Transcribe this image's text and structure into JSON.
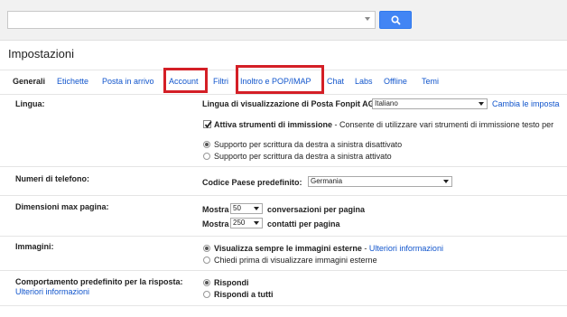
{
  "search": {
    "placeholder": ""
  },
  "page": {
    "title": "Impostazioni"
  },
  "tabs": [
    {
      "label": "Generali"
    },
    {
      "label": "Etichette"
    },
    {
      "label": "Posta in arrivo"
    },
    {
      "label": "Account"
    },
    {
      "label": "Filtri"
    },
    {
      "label": "Inoltro e POP/IMAP"
    },
    {
      "label": "Chat"
    },
    {
      "label": "Labs"
    },
    {
      "label": "Offline"
    },
    {
      "label": "Temi"
    }
  ],
  "highlight_color": "#d41f26",
  "sections": {
    "lingua": {
      "label": "Lingua:",
      "display_label": "Lingua di visualizzazione di Posta Fonpit AG:",
      "language_value": "Italiano",
      "change_link": "Cambia le imposta",
      "input_tools_label": "Attiva strumenti di immissione",
      "input_tools_desc": " - Consente di utilizzare vari strumenti di immissione testo per",
      "rtl_off": "Supporto per scrittura da destra a sinistra disattivato",
      "rtl_on": "Supporto per scrittura da destra a sinistra attivato"
    },
    "phone": {
      "label": "Numeri di telefono:",
      "country_label": "Codice Paese predefinito:",
      "country_value": "Germania"
    },
    "page_size": {
      "label": "Dimensioni max pagina:",
      "show1": "Mostra",
      "conv_value": "50",
      "conv_suffix": "conversazioni per pagina",
      "show2": "Mostra",
      "contacts_value": "250",
      "contacts_suffix": "contatti per pagina"
    },
    "images": {
      "label": "Immagini:",
      "always": "Visualizza sempre le immagini esterne",
      "sep": " - ",
      "more_info": "Ulteriori informazioni",
      "ask": "Chiedi prima di visualizzare immagini esterne"
    },
    "reply": {
      "label": "Comportamento predefinito per la risposta:",
      "more_info": "Ulteriori informazioni",
      "reply": "Rispondi",
      "reply_all": "Rispondi a tutti"
    }
  }
}
